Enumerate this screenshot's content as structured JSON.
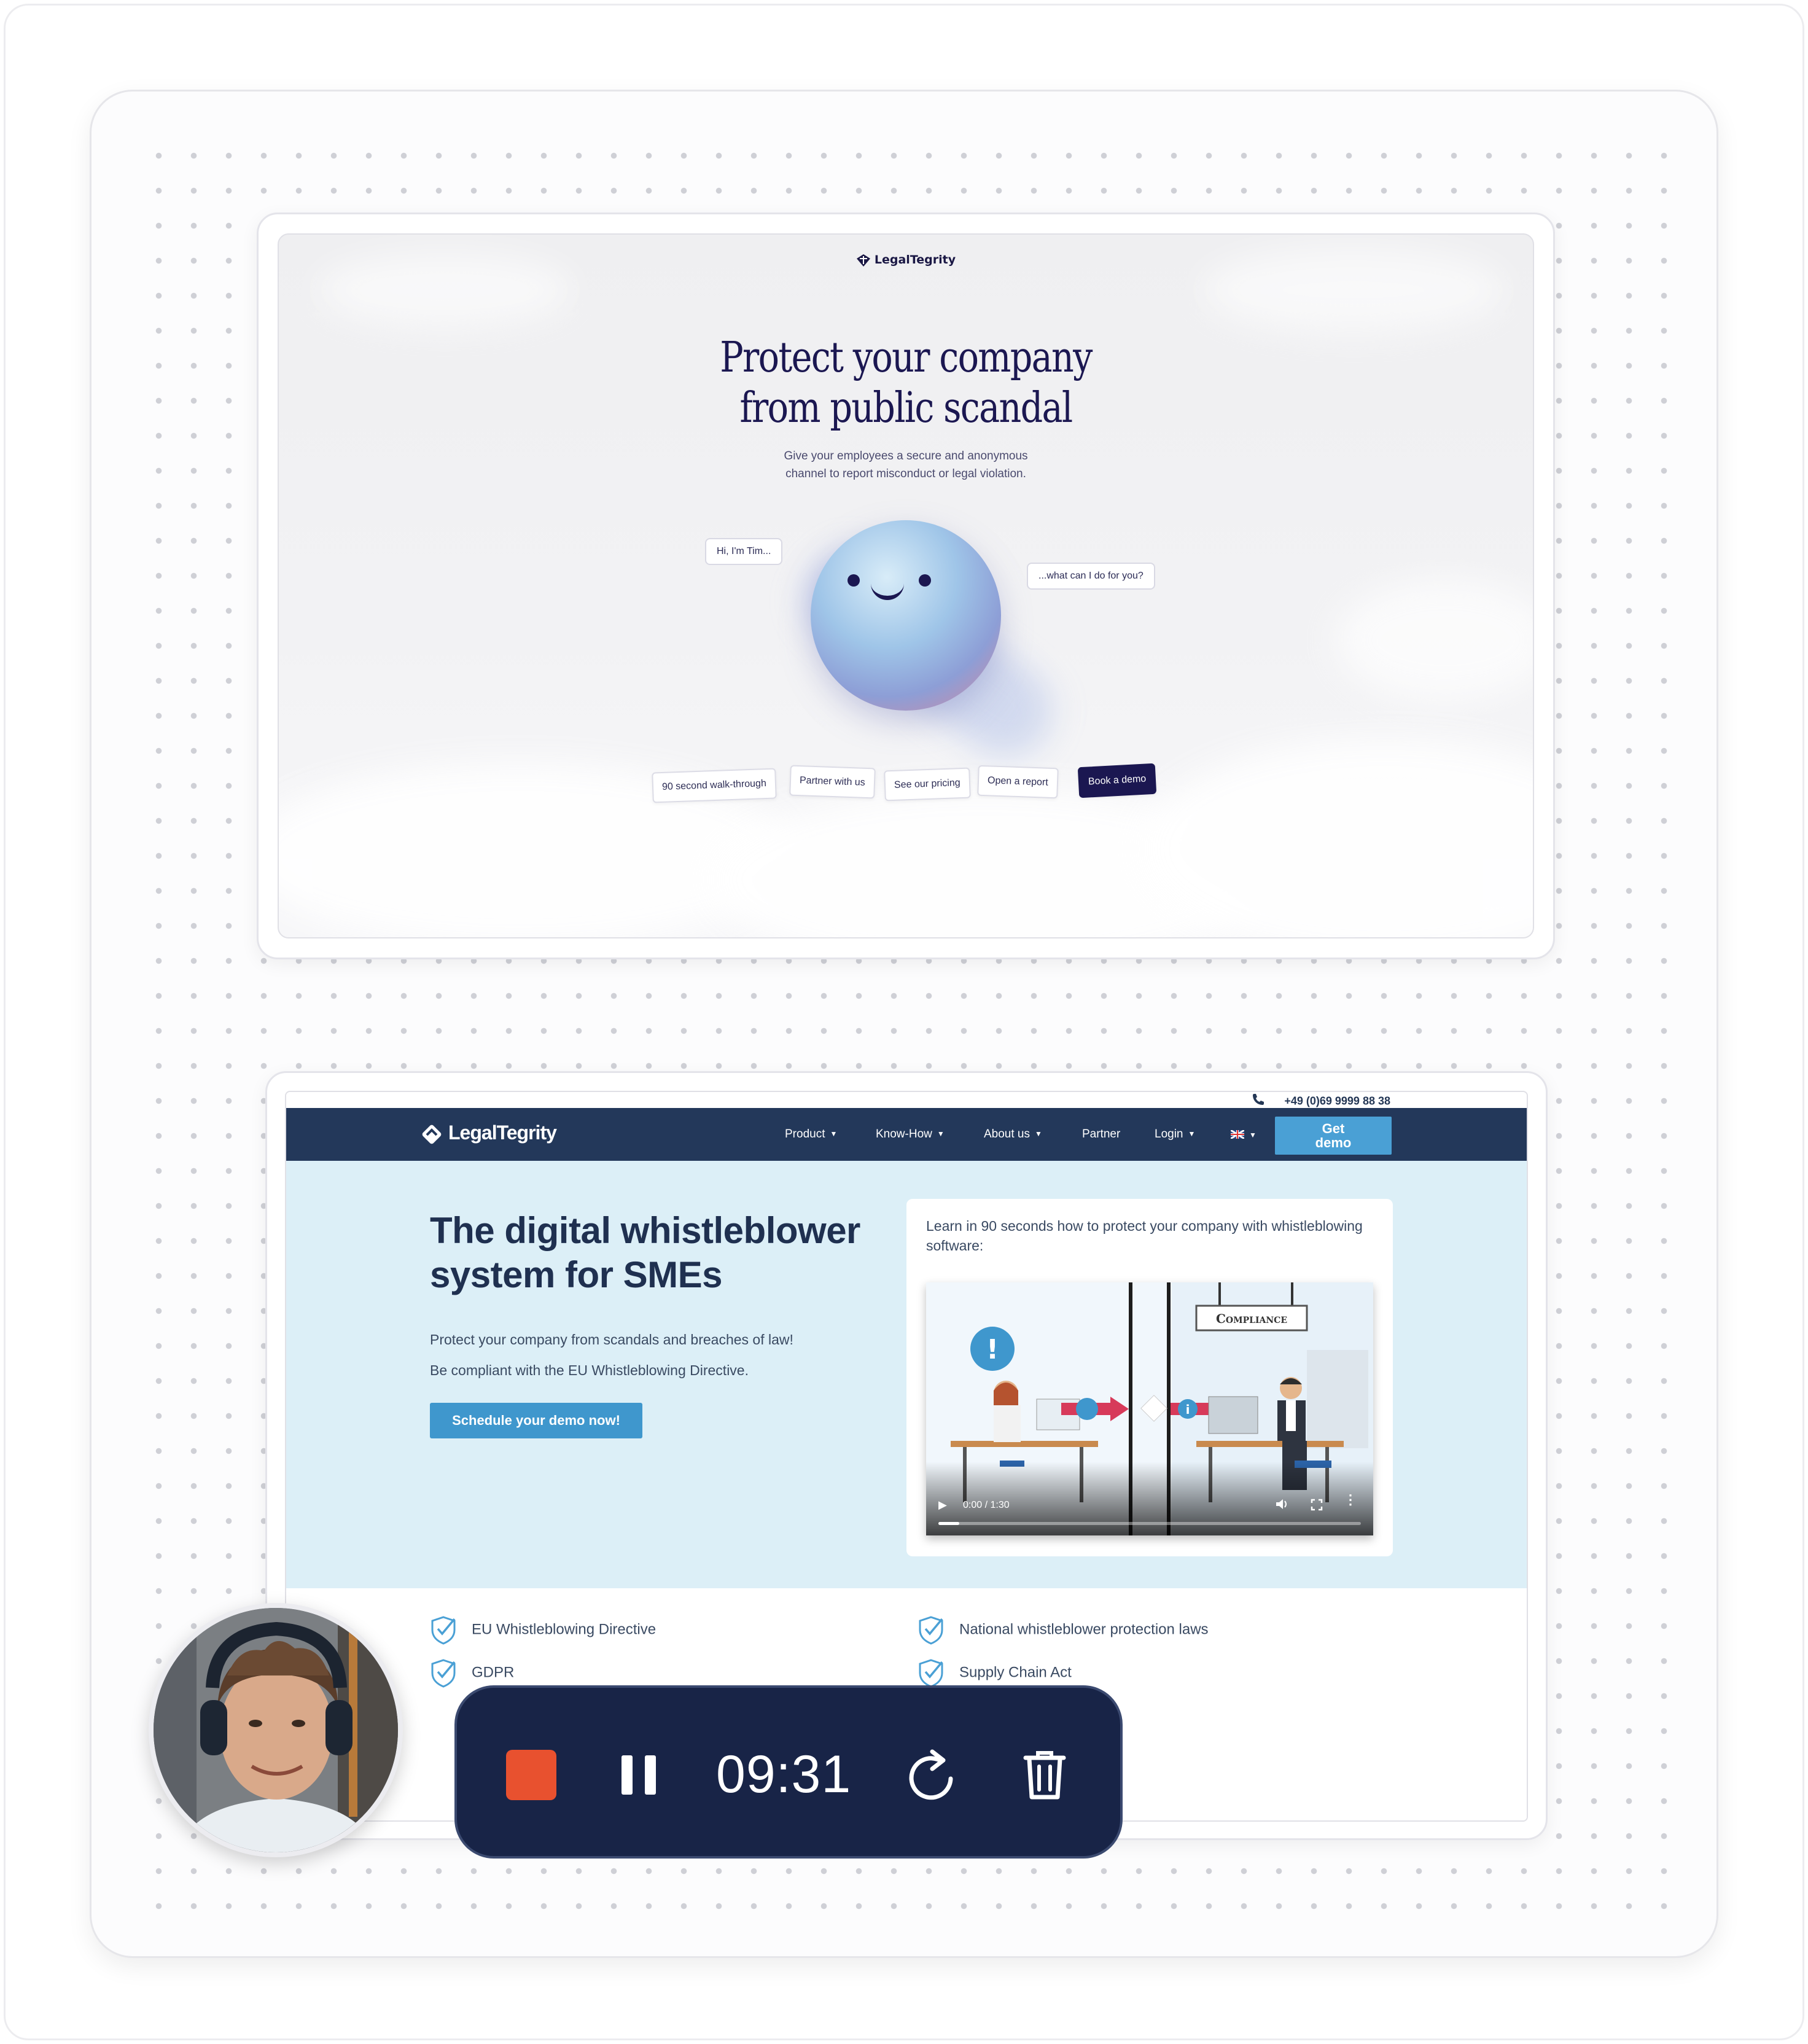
{
  "screenshot1": {
    "brand": "LegalTegrity",
    "headline_line1": "Protect your company",
    "headline_line2": "from public scandal",
    "subtitle_line1": "Give your employees a secure and anonymous",
    "subtitle_line2": "channel to report misconduct or legal violation.",
    "bubble_left": "Hi, I'm Tim...",
    "bubble_right": "...what can I do for you?",
    "chips": [
      "90 second walk-through",
      "Partner with us",
      "See our pricing",
      "Open a report",
      "Book a demo"
    ]
  },
  "screenshot2": {
    "phone": "+49 (0)69 9999 88 38",
    "brand": "LegalTegrity",
    "nav": [
      "Product",
      "Know-How",
      "About us",
      "Partner",
      "Login"
    ],
    "get_demo_line1": "Get",
    "get_demo_line2": "demo",
    "hero_title_line1": "The digital whistleblower",
    "hero_title_line2": "system for SMEs",
    "hero_sub_line1": "Protect your company from scandals and breaches of law!",
    "hero_sub_line2": "Be compliant with the EU Whistleblowing Directive.",
    "hero_cta": "Schedule your demo now!",
    "video_caption": "Learn in 90 seconds how to protect your company with whistleblowing software:",
    "video_sign": "Compliance",
    "video_time": "0:00 / 1:30",
    "video_progress": 0.05,
    "features": [
      "EU Whistleblowing Directive",
      "National whistleblower protection laws",
      "GDPR",
      "Supply Chain Act"
    ]
  },
  "recorder": {
    "time": "09:31",
    "colors": {
      "bar": "#182447",
      "stop": "#e8512f"
    },
    "icons": [
      "stop-icon",
      "pause-icon",
      "restart-icon",
      "trash-icon"
    ]
  }
}
